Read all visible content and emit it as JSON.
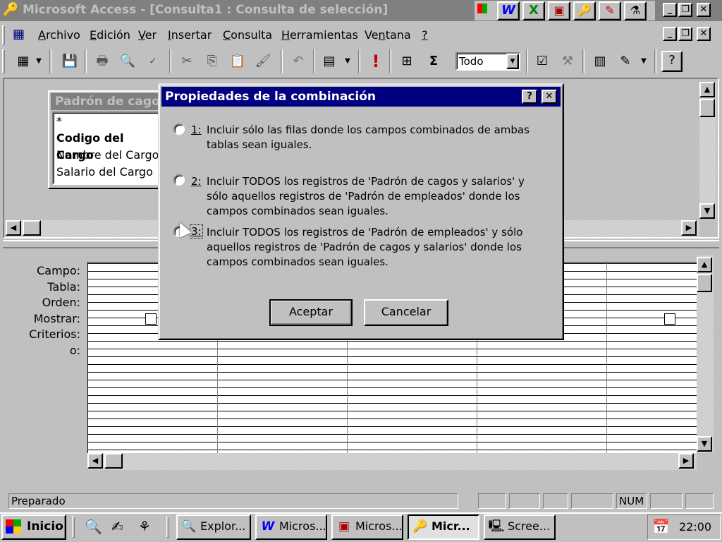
{
  "window": {
    "title": "Microsoft Access - [Consulta1 : Consulta de selección]",
    "title_icon": "keys-icon"
  },
  "office_bar": {
    "icons": [
      "office-logo-icon",
      "word-icon",
      "excel-icon",
      "powerpoint-icon",
      "access-icon",
      "outlook-icon",
      "binder-icon"
    ]
  },
  "menu": {
    "items": [
      {
        "label": "Archivo",
        "ul": "A"
      },
      {
        "label": "Edición",
        "ul": "E"
      },
      {
        "label": "Ver",
        "ul": "V"
      },
      {
        "label": "Insertar",
        "ul": "I"
      },
      {
        "label": "Consulta",
        "ul": "C"
      },
      {
        "label": "Herramientas",
        "ul": "H"
      },
      {
        "label": "Ventana",
        "ul": "n"
      },
      {
        "label": "?",
        "ul": "?"
      }
    ]
  },
  "toolbar": {
    "top_values_value": "Todo",
    "sigma": "Σ",
    "run": "!"
  },
  "table_box": {
    "title": "Padrón de cagos",
    "fields": [
      "*",
      "Codigo del Cargo",
      "Nombre del Cargo",
      "Salario del Cargo"
    ]
  },
  "grid": {
    "row_labels": [
      "Campo:",
      "Tabla:",
      "Orden:",
      "Mostrar:",
      "Criterios:",
      "o:"
    ]
  },
  "dialog": {
    "title": "Propiedades de la combinación",
    "help_label": "?",
    "close_label": "✕",
    "options": [
      {
        "num": "1",
        "text": "Incluir sólo las filas donde los campos combinados de ambas tablas sean iguales."
      },
      {
        "num": "2",
        "text": "Incluir TODOS los registros de 'Padrón de cagos y salarios' y sólo aquellos registros de 'Padrón de empleados' donde los campos combinados sean iguales."
      },
      {
        "num": "3",
        "text": "Incluir TODOS los registros de 'Padrón de empleados' y sólo aquellos registros de 'Padrón de cagos y salarios' donde los campos combinados sean iguales."
      }
    ],
    "ok_label": "Aceptar",
    "cancel_label": "Cancelar"
  },
  "status": {
    "text": "Preparado",
    "num": "NUM"
  },
  "taskbar": {
    "start_label": "Inicio",
    "tasks": [
      {
        "label": "Explor...",
        "icon": "explorer-icon"
      },
      {
        "label": "Micros...",
        "icon": "word-icon"
      },
      {
        "label": "Micros...",
        "icon": "powerpoint-icon"
      },
      {
        "label": "Micr...",
        "icon": "access-icon",
        "active": true
      },
      {
        "label": "Scree...",
        "icon": "screen-icon"
      }
    ],
    "clock": "22:00"
  }
}
